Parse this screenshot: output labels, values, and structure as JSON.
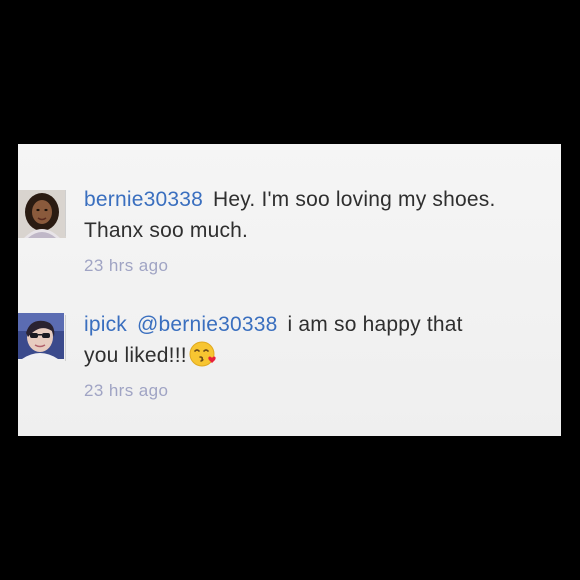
{
  "comments": [
    {
      "username": "bernie30338",
      "text_line1": "Hey. I'm soo loving my shoes.",
      "text_line2": "Thanx soo much.",
      "time": "23 hrs ago",
      "avatar_icon": "user-avatar-photo"
    },
    {
      "username": "ipick",
      "mention": "@bernie30338",
      "text_line1": "i am so happy that",
      "text_line2": "you liked!!!",
      "emoji_icon": "kissing-face-emoji",
      "time": "23 hrs ago",
      "avatar_icon": "user-avatar-photo"
    }
  ],
  "colors": {
    "username": "#3a6fbf",
    "timestamp": "#a0a4c4",
    "text": "#2f2f2f",
    "panel_bg": "#f2f2f2",
    "frame_bg": "#000000"
  }
}
